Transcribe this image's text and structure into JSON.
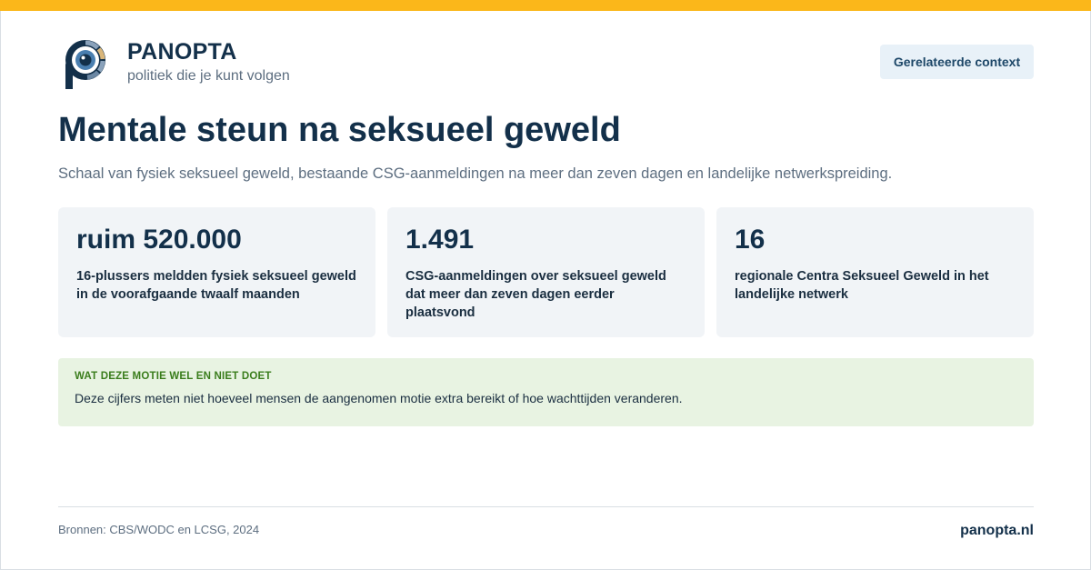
{
  "brand": {
    "name": "PANOPTA",
    "tagline": "politiek die je kunt volgen",
    "logo_icon": "panopta-eye-logo",
    "accent_color": "#fbb71a",
    "primary_color": "#13304a"
  },
  "header": {
    "context_button_label": "Gerelateerde context"
  },
  "main": {
    "title": "Mentale steun na seksueel geweld",
    "subtitle": "Schaal van fysiek seksueel geweld, bestaande CSG-aanmeldingen na meer dan zeven dagen en landelijke netwerkspreiding.",
    "stats": [
      {
        "value": "ruim 520.000",
        "label": "16-plussers meldden fysiek seksueel geweld in de voorafgaande twaalf maanden"
      },
      {
        "value": "1.491",
        "label": "CSG-aanmeldingen over seksueel geweld dat meer dan zeven dagen eerder plaatsvond"
      },
      {
        "value": "16",
        "label": "regionale Centra Seksueel Geweld in het landelijke netwerk"
      }
    ],
    "note": {
      "heading": "WAT DEZE MOTIE WEL EN NIET DOET",
      "text": "Deze cijfers meten niet hoeveel mensen de aangenomen motie extra bereikt of hoe wachttijden veranderen."
    }
  },
  "footer": {
    "sources": "Bronnen: CBS/WODC en LCSG, 2024",
    "site": "panopta.nl"
  }
}
